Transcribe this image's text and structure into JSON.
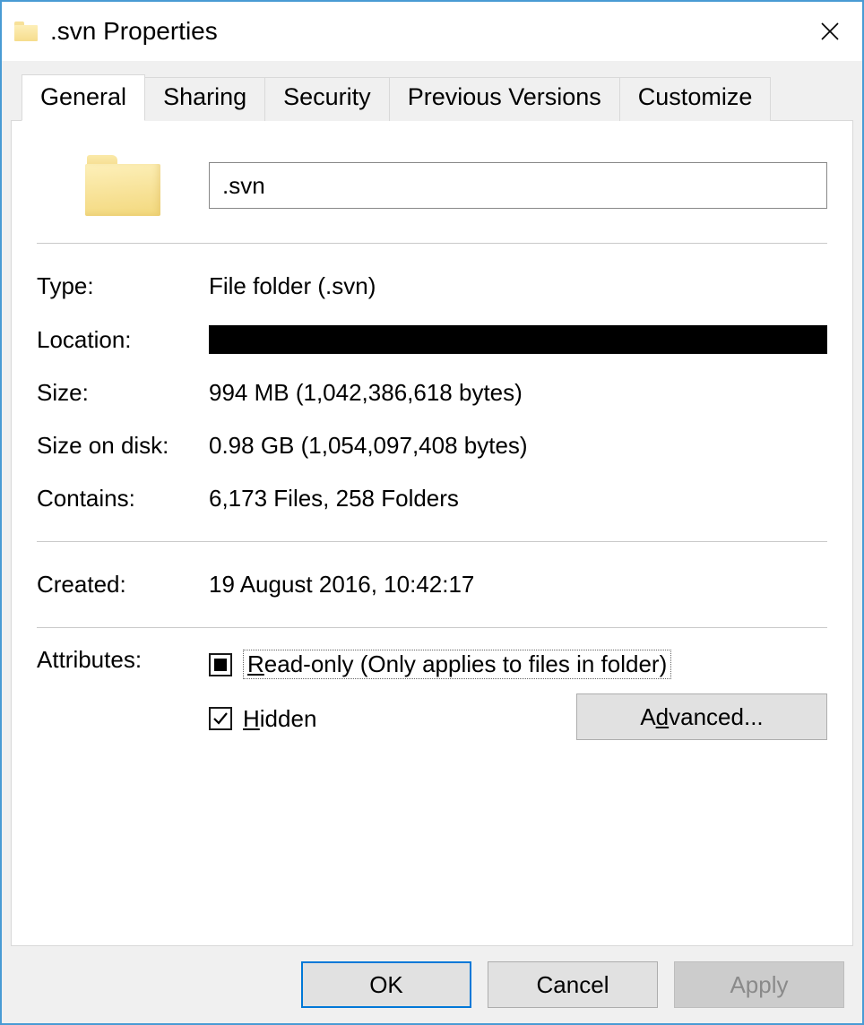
{
  "titlebar": {
    "title": ".svn Properties"
  },
  "tabs": {
    "general": "General",
    "sharing": "Sharing",
    "security": "Security",
    "previous": "Previous Versions",
    "customize": "Customize"
  },
  "general": {
    "name": ".svn",
    "type_label": "Type:",
    "type_value": "File folder (.svn)",
    "location_label": "Location:",
    "size_label": "Size:",
    "size_value": "994 MB (1,042,386,618 bytes)",
    "size_on_disk_label": "Size on disk:",
    "size_on_disk_value": "0.98 GB (1,054,097,408 bytes)",
    "contains_label": "Contains:",
    "contains_value": "6,173 Files, 258 Folders",
    "created_label": "Created:",
    "created_value": "19 August 2016, 10:42:17",
    "attributes_label": "Attributes:",
    "readonly_prefix": "R",
    "readonly_rest": "ead-only (Only applies to files in folder)",
    "hidden_prefix": "H",
    "hidden_rest": "idden",
    "advanced_prefix": "A",
    "advanced_rest": "vanced..."
  },
  "buttons": {
    "ok": "OK",
    "cancel": "Cancel",
    "apply": "Apply"
  }
}
